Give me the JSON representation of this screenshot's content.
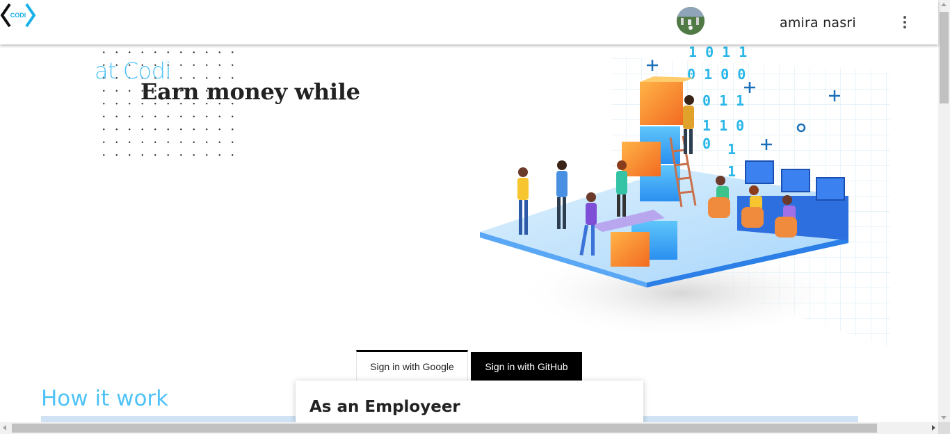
{
  "header": {
    "logo_text": "CODI",
    "user_name": "amira nasri",
    "menu_icon": "more-vert-icon"
  },
  "hero": {
    "subtitle": "at Codi",
    "headline": "Earn money while",
    "binary_rows": [
      "1011",
      "0100",
      "011",
      "110",
      "0",
      "1",
      "1"
    ]
  },
  "auth": {
    "google_label": "Sign in with Google",
    "github_label": "Sign in with GitHub"
  },
  "how_it_works": {
    "title": "How it work",
    "card_title": "As an Employeer"
  },
  "colors": {
    "accent": "#4fc3f7",
    "band": "#cfe3f5",
    "logo_blue": "#1ab0e8"
  }
}
